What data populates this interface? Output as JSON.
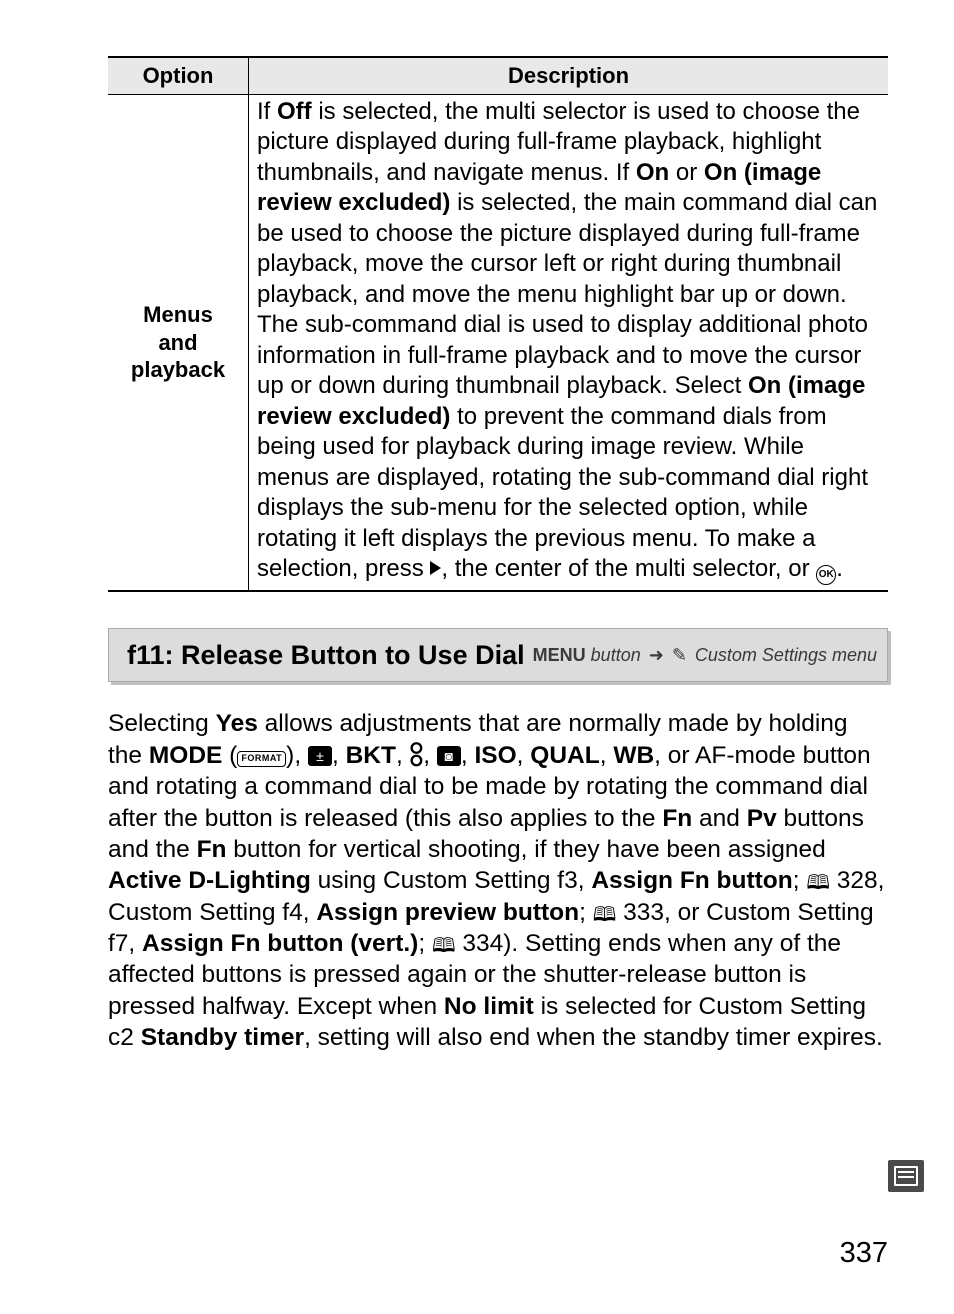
{
  "table": {
    "headers": {
      "option": "Option",
      "description": "Description"
    },
    "row": {
      "option_l1": "Menus",
      "option_l2": "and",
      "option_l3": "playback",
      "d1a": "If ",
      "d1b": "Off",
      "d1c": " is selected, the multi selector is used to choose the picture displayed during full-frame playback, highlight thumbnails, and navigate menus.  If ",
      "d2a": "On",
      "d2b": " or ",
      "d2c": "On (image review excluded)",
      "d2d": " is selected, the main command dial can be used to choose the picture displayed during full-frame playback, move the cursor left or right during thumbnail playback, and move the menu highlight bar up or down.  The sub-command dial is used to display additional photo information in full-frame playback and to move the cursor up or down during thumbnail playback.  Select ",
      "d3a": "On (image review excluded)",
      "d3b": " to prevent the command dials from being used for playback during image review.  While menus are displayed, rotating the sub-command dial right displays the sub-menu for the selected option, while rotating it left displays the previous menu.  To make a selection, press ",
      "d4a": ", the center of the multi selector, or ",
      "d4b": ".",
      "ok_label": "OK"
    }
  },
  "section": {
    "title": "f11: Release Button to Use Dial",
    "menu_word": "MENU",
    "button_word": " button",
    "arrow": "➜",
    "menu_name": "Custom Settings menu"
  },
  "body": {
    "t1a": "Selecting ",
    "t1b": "Yes",
    "t1c": " allows adjustments that are normally made by holding the ",
    "mode": "MODE",
    "format": "FORMAT",
    "comma": ", ",
    "pm": "±",
    "bkt": "BKT",
    "flash": "⯼",
    "meter": "◙",
    "iso": "ISO",
    "qual": "QUAL",
    "wb": "WB",
    "t2": ", or AF-mode button and rotating a command dial to be made by rotating the command dial after the button is released (this also applies to the ",
    "fn": "Fn",
    "t3": " and ",
    "pv": "Pv",
    "t4": " buttons and the ",
    "t5": " button for vertical shooting, if they have been assigned ",
    "adl": "Active D-Lighting",
    "t6": " using Custom Setting f3, ",
    "assign_fn": "Assign Fn button",
    "p328": " 328, Custom Setting f4, ",
    "assign_pv": "Assign preview button",
    "p333": " 333, or Custom Setting f7, ",
    "assign_vert": "Assign Fn button (vert.)",
    "p334": " 334).  Setting ends when any of the affected buttons is pressed again or the shutter-release button is pressed halfway.  Except when ",
    "nolimit": "No limit",
    "t7": " is selected for Custom Setting c2 ",
    "standby": "Standby timer",
    "t8": ", setting will also end when the standby timer expires.",
    "semi": "; "
  },
  "page_number": "337"
}
